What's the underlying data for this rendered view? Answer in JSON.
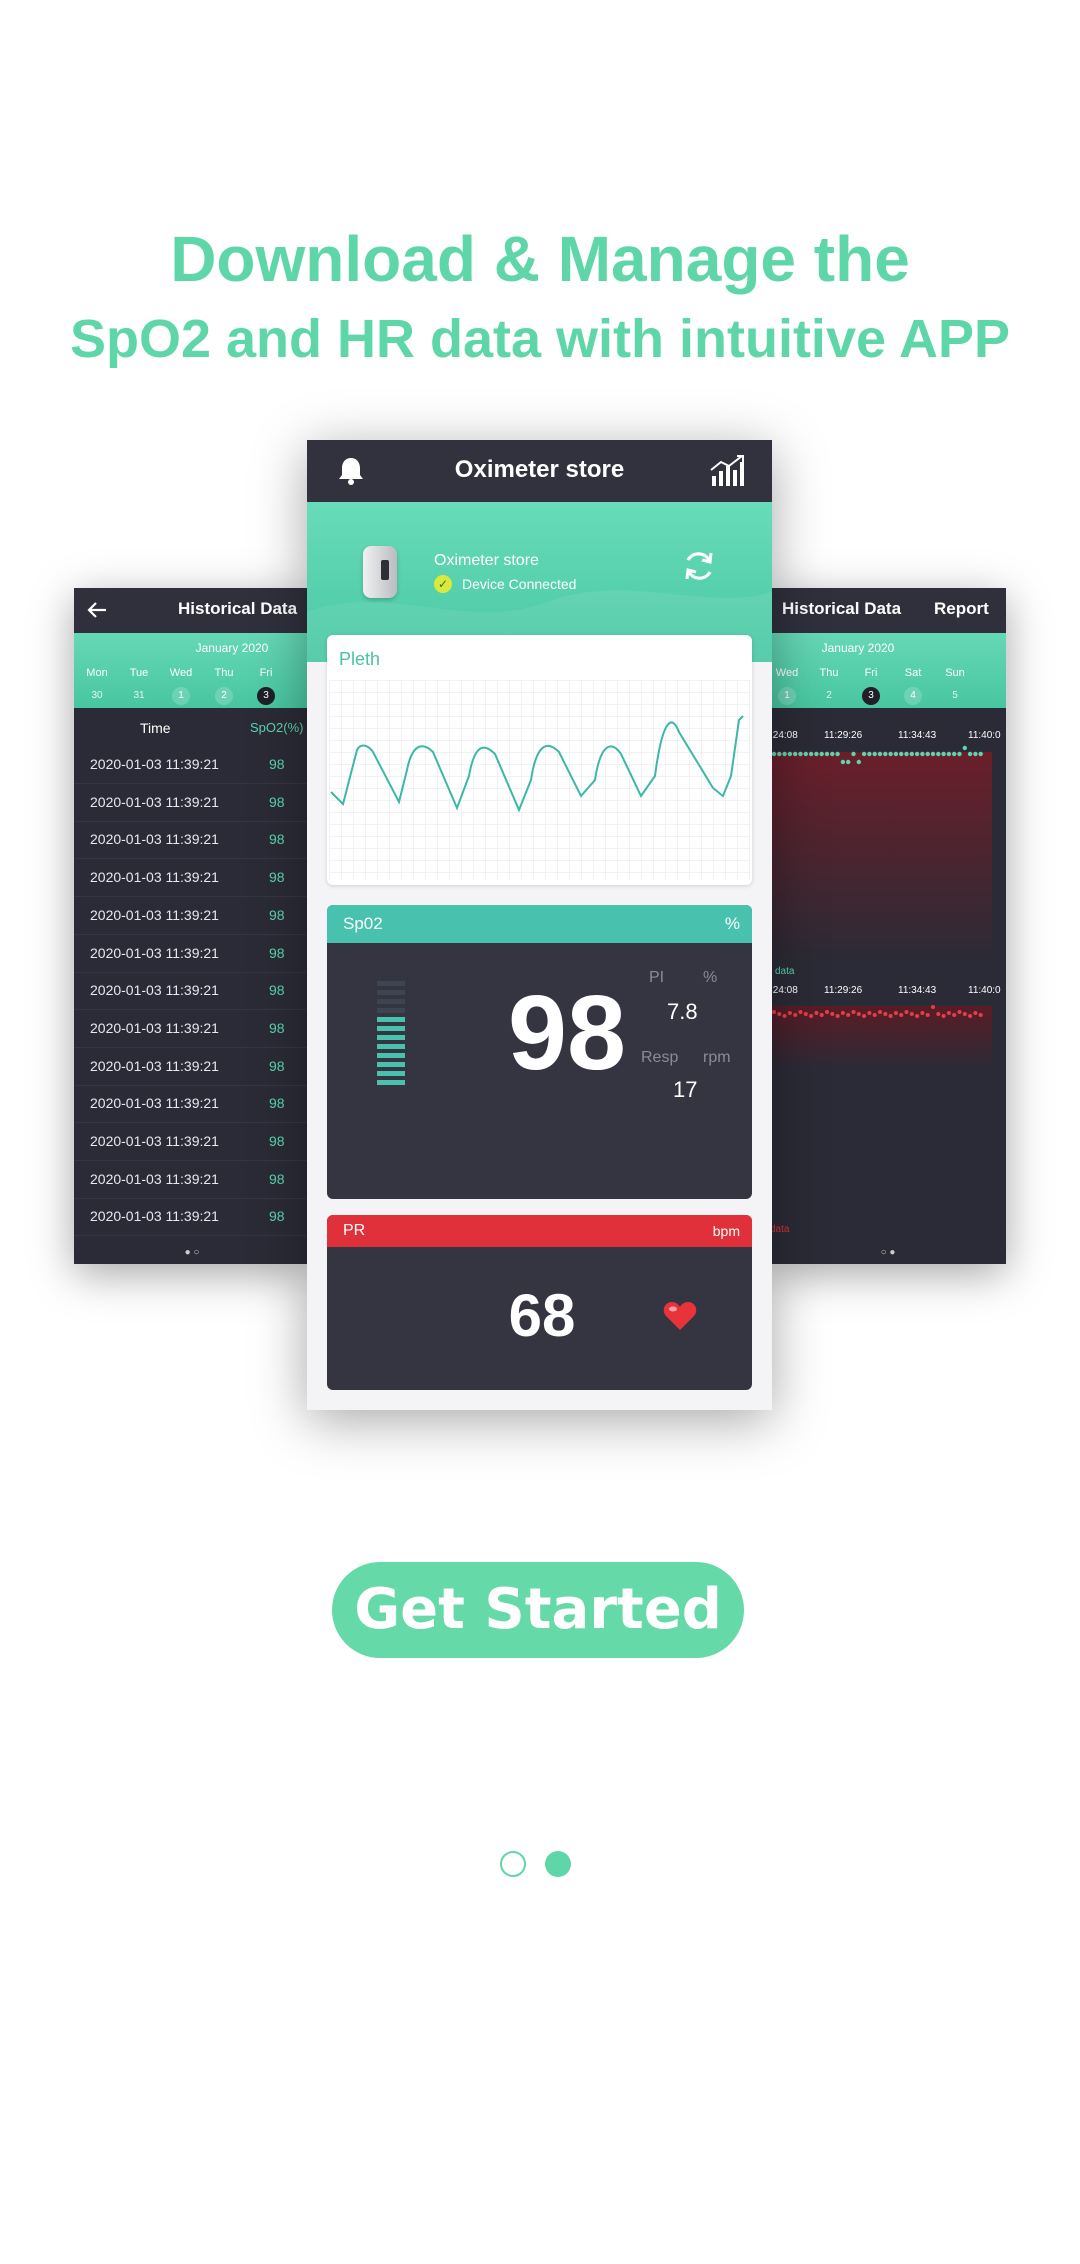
{
  "headline": {
    "line1": "Download & Manage the",
    "line2": "SpO2 and HR data with intuitive APP"
  },
  "left_phone": {
    "title": "Historical Data",
    "month": "January 2020",
    "days": [
      "Mon",
      "Tue",
      "Wed",
      "Thu",
      "Fri"
    ],
    "dates": [
      "30",
      "31",
      "1",
      "2",
      "3"
    ],
    "columns": [
      "Time",
      "SpO2(%)"
    ],
    "rows": [
      {
        "time": "2020-01-03 11:39:21",
        "spo2": "98"
      },
      {
        "time": "2020-01-03 11:39:21",
        "spo2": "98"
      },
      {
        "time": "2020-01-03 11:39:21",
        "spo2": "98"
      },
      {
        "time": "2020-01-03 11:39:21",
        "spo2": "98"
      },
      {
        "time": "2020-01-03 11:39:21",
        "spo2": "98"
      },
      {
        "time": "2020-01-03 11:39:21",
        "spo2": "98"
      },
      {
        "time": "2020-01-03 11:39:21",
        "spo2": "98"
      },
      {
        "time": "2020-01-03 11:39:21",
        "spo2": "98"
      },
      {
        "time": "2020-01-03 11:39:21",
        "spo2": "98"
      },
      {
        "time": "2020-01-03 11:39:21",
        "spo2": "98"
      },
      {
        "time": "2020-01-03 11:39:21",
        "spo2": "98"
      },
      {
        "time": "2020-01-03 11:39:21",
        "spo2": "98"
      },
      {
        "time": "2020-01-03 11:39:21",
        "spo2": "98"
      }
    ]
  },
  "right_phone": {
    "title": "Historical Data",
    "report_label": "Report",
    "month": "January 2020",
    "days": [
      "Wed",
      "Thu",
      "Fri",
      "Sat",
      "Sun"
    ],
    "dates": [
      "1",
      "2",
      "3",
      "4",
      "5"
    ],
    "time_ticks": [
      ":24:08",
      "11:29:26",
      "11:34:43",
      "11:40:0"
    ],
    "legend_spo2": "l data",
    "legend_pr": "data"
  },
  "center_phone": {
    "app_title": "Oximeter store",
    "device_name": "Oximeter store",
    "device_status": "Device Connected",
    "pleth_label": "Pleth",
    "spo2": {
      "label": "Sp02",
      "unit": "%",
      "value": "98",
      "pi_label": "PI",
      "pi_unit": "%",
      "pi_value": "7.8",
      "resp_label": "Resp",
      "resp_unit": "rpm",
      "resp_value": "17"
    },
    "pr": {
      "label": "PR",
      "unit": "bpm",
      "value": "68"
    }
  },
  "cta": {
    "label": "Get Started"
  },
  "pager": {
    "current": 2,
    "total": 2
  },
  "colors": {
    "accent": "#5fd6a8",
    "teal": "#48c2ae",
    "red": "#e03039",
    "dark": "#353541"
  }
}
